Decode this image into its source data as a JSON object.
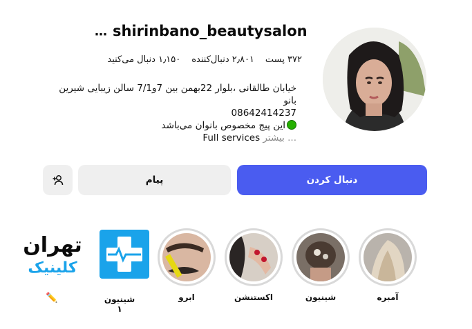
{
  "profile": {
    "username": "shirinbano_beautysalon",
    "more_icon": "more-dots-icon",
    "stats": {
      "posts": "۳۷۲ پست",
      "followers": "۲٫۸۰۱ دنبال‌کننده",
      "following": "۱٫۱۵۰ دنبال می‌کنید"
    },
    "bio": {
      "line1": "خیابان طالقانی ،بلوار 22بهمن بین 7و7/1 سالن زیبایی شیرین",
      "line2": "بانو",
      "phone": "08642414237",
      "line4": "این پیج مخصوص بانوان می‌باشد",
      "line5": "Full services",
      "more": "بیشتر ..."
    }
  },
  "actions": {
    "follow": "دنبال کردن",
    "message": "پیام",
    "suggest_icon": "add-person-icon"
  },
  "highlights": [
    {
      "label": "آمبره"
    },
    {
      "label": "شینیون"
    },
    {
      "label": "اکستنشن"
    },
    {
      "label": "ابرو"
    },
    {
      "label": "شینیون ۱"
    }
  ],
  "clinic": {
    "title": "تهران",
    "subtitle": "کلینیک"
  },
  "colors": {
    "accent": "#4a5cf0",
    "button_gray": "#efefef",
    "ring": "#d9d9d9",
    "clinic_blue": "#1aa3ea",
    "status_green": "#25b000"
  }
}
